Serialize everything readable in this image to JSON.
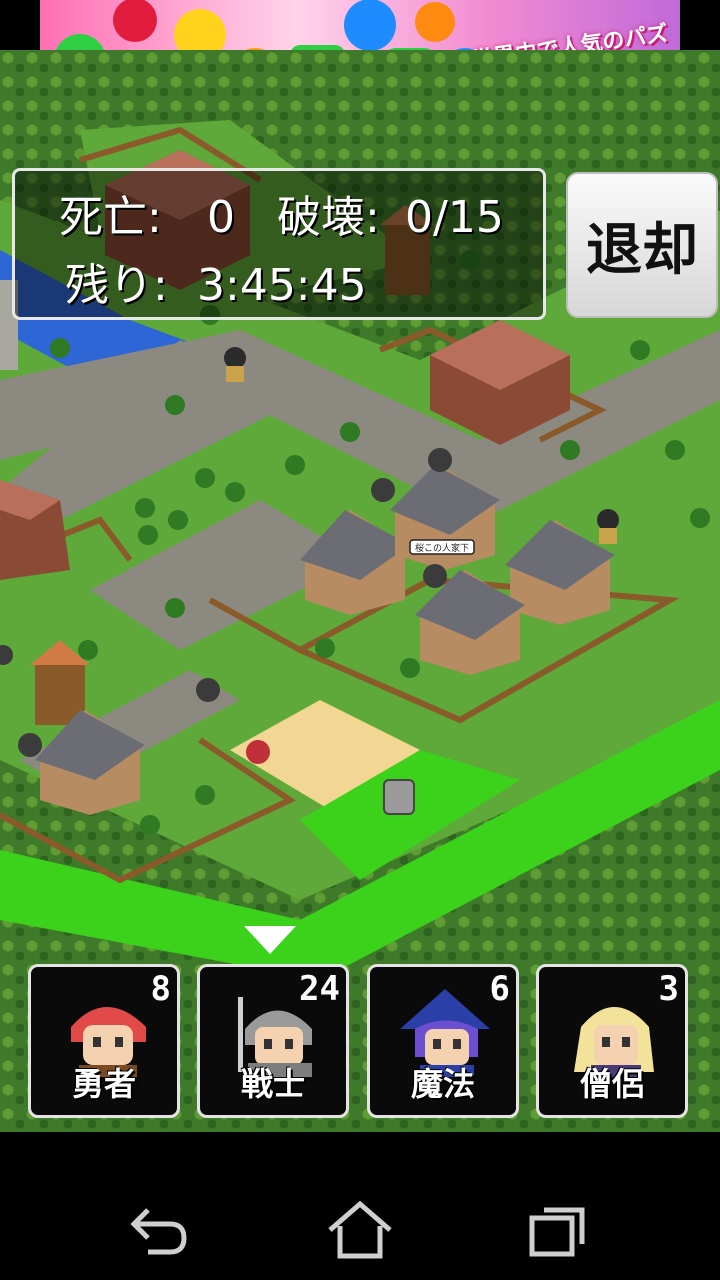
{
  "ad": {
    "text": "世界中で人気のパズルゲーム"
  },
  "hud": {
    "deaths_label": "死亡:",
    "deaths_value": "0",
    "destroy_label": "破壊:",
    "destroy_value": "0/15",
    "remaining_label": "残り:",
    "remaining_value": "3:45:45"
  },
  "retreat_button": {
    "label": "退却"
  },
  "map": {
    "sign_text": "桜この人家下"
  },
  "units": [
    {
      "name": "勇者",
      "count": "8",
      "hair": "#e24a4a"
    },
    {
      "name": "戦士",
      "count": "24",
      "hair": "#9a9a9a"
    },
    {
      "name": "魔法",
      "count": "6",
      "hair": "#6b4fd0"
    },
    {
      "name": "僧侶",
      "count": "3",
      "hair": "#f3e39a"
    }
  ],
  "navbar": {
    "icons": [
      "back-icon",
      "home-icon",
      "recent-apps-icon"
    ]
  },
  "colors": {
    "grass": "#5fa83a",
    "road": "#8c8a80",
    "path": "#3cd21c",
    "water": "#2e66d6",
    "roof": "#6c6c74"
  }
}
